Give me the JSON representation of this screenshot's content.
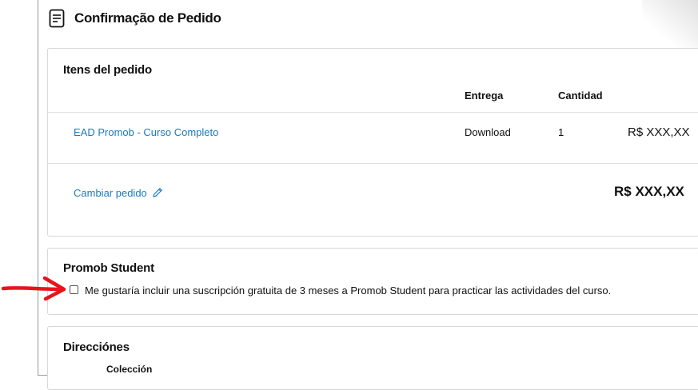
{
  "header": {
    "title": "Confirmação de Pedido",
    "icon": "document-icon"
  },
  "items": {
    "title": "Itens del pedido",
    "columns": {
      "delivery": "Entrega",
      "quantity": "Cantidad"
    },
    "rows": [
      {
        "product": "EAD Promob - Curso Completo",
        "delivery": "Download",
        "quantity": "1",
        "price": "R$ XXX,XX"
      }
    ],
    "change_order": "Cambiar pedido",
    "total": "R$ XXX,XX"
  },
  "student": {
    "title": "Promob Student",
    "checkbox_label": "Me gustaría incluir una suscripción gratuita de 3 meses a Promob Student para practicar las actividades del curso.",
    "checked": false
  },
  "addresses": {
    "title": "Direcciónes",
    "subheading": "Colección"
  },
  "colors": {
    "link": "#1a7bbf",
    "annotation_arrow": "#e8141b"
  }
}
